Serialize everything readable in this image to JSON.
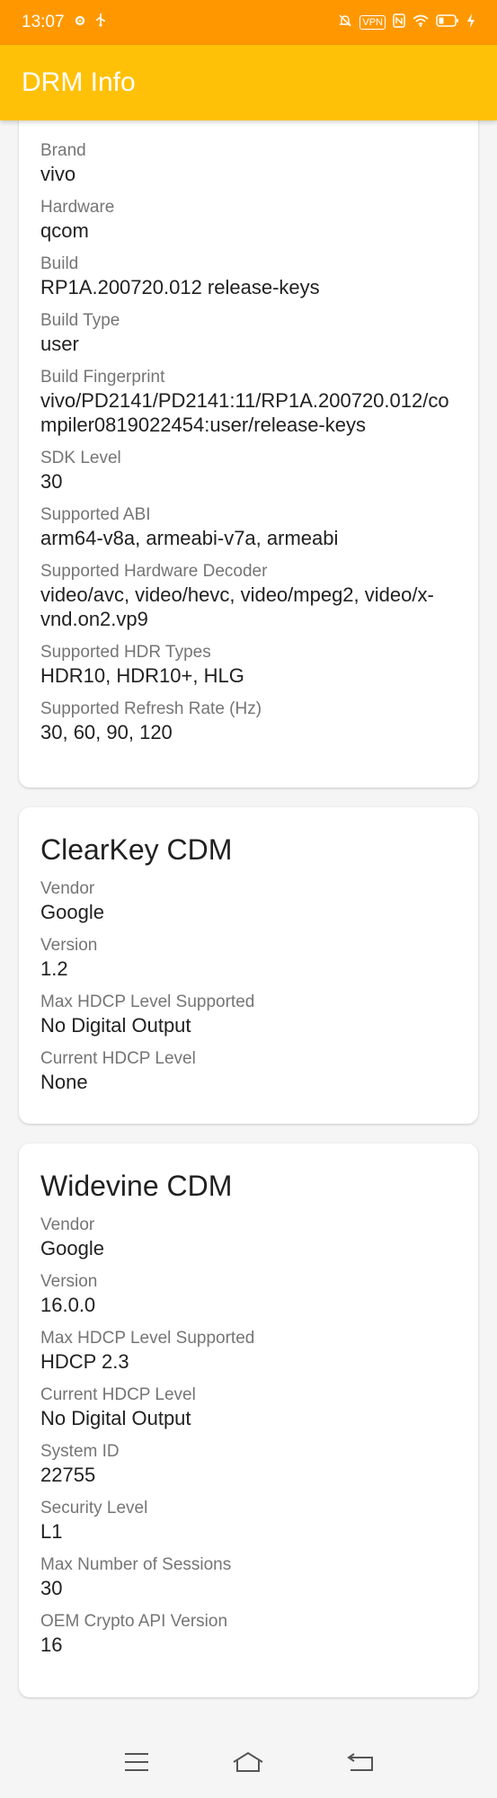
{
  "status_bar": {
    "time": "13:07",
    "left_icons": [
      "settings-gear-icon",
      "usb-icon"
    ],
    "right_icons": [
      "mute-icon",
      "vpn-badge",
      "nfc-icon",
      "wifi-icon",
      "battery-icon",
      "charging-icon"
    ],
    "vpn_label": "VPN"
  },
  "app_bar": {
    "title": "DRM Info"
  },
  "device_card": {
    "fields": [
      {
        "label": "Brand",
        "value": "vivo"
      },
      {
        "label": "Hardware",
        "value": "qcom"
      },
      {
        "label": "Build",
        "value": "RP1A.200720.012 release-keys"
      },
      {
        "label": "Build Type",
        "value": "user"
      },
      {
        "label": "Build Fingerprint",
        "value": "vivo/PD2141/PD2141:11/RP1A.200720.012/compiler0819022454:user/release-keys"
      },
      {
        "label": "SDK Level",
        "value": "30"
      },
      {
        "label": "Supported ABI",
        "value": "arm64-v8a, armeabi-v7a, armeabi"
      },
      {
        "label": "Supported Hardware Decoder",
        "value": "video/avc, video/hevc, video/mpeg2, video/x-vnd.on2.vp9"
      },
      {
        "label": "Supported HDR Types",
        "value": "HDR10, HDR10+, HLG"
      },
      {
        "label": "Supported Refresh Rate (Hz)",
        "value": "30, 60, 90, 120"
      }
    ]
  },
  "clearkey_card": {
    "title": "ClearKey CDM",
    "fields": [
      {
        "label": "Vendor",
        "value": "Google"
      },
      {
        "label": "Version",
        "value": "1.2"
      },
      {
        "label": "Max HDCP Level Supported",
        "value": "No Digital Output"
      },
      {
        "label": "Current HDCP Level",
        "value": "None"
      }
    ]
  },
  "widevine_card": {
    "title": "Widevine CDM",
    "fields": [
      {
        "label": "Vendor",
        "value": "Google"
      },
      {
        "label": "Version",
        "value": "16.0.0"
      },
      {
        "label": "Max HDCP Level Supported",
        "value": "HDCP 2.3"
      },
      {
        "label": "Current HDCP Level",
        "value": "No Digital Output"
      },
      {
        "label": "System ID",
        "value": "22755"
      },
      {
        "label": "Security Level",
        "value": "L1"
      },
      {
        "label": "Max Number of Sessions",
        "value": "30"
      },
      {
        "label": "OEM Crypto API Version",
        "value": "16"
      }
    ]
  },
  "nav_bar": {
    "buttons": [
      "menu-icon",
      "home-icon",
      "back-icon"
    ]
  }
}
